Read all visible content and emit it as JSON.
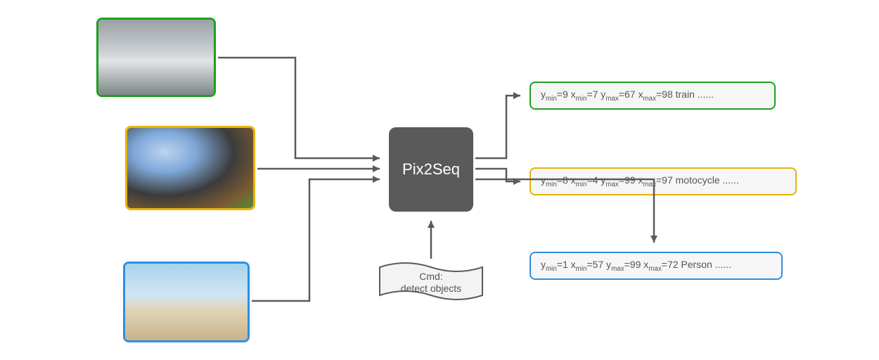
{
  "model": {
    "label": "Pix2Seq"
  },
  "command": {
    "line1": "Cmd:",
    "line2": "detect objects"
  },
  "inputs": [
    {
      "id": "train",
      "border": "#1ea01e",
      "bg_top": "#8a8f8a",
      "bg_bot": "#cfd3cf",
      "desc": "bullet-train-photo"
    },
    {
      "id": "moto",
      "border": "#e8b400",
      "bg_top": "#6aa0e0",
      "bg_bot": "#8a6a40",
      "desc": "motorcycle-photo"
    },
    {
      "id": "person",
      "border": "#2e8fe0",
      "bg_top": "#9ec8e8",
      "bg_bot": "#d9c8a8",
      "desc": "person-bicycle-photo"
    }
  ],
  "outputs": [
    {
      "id": "train",
      "border": "#1ea01e",
      "ymin": 9,
      "xmin": 7,
      "ymax": 67,
      "xmax": 98,
      "label": "train",
      "suffix": " ......"
    },
    {
      "id": "moto",
      "border": "#e8b400",
      "ymin": 8,
      "xmin": 4,
      "ymax": 99,
      "xmax": 97,
      "label": "motocycle",
      "suffix": " ......"
    },
    {
      "id": "person",
      "border": "#2e8fe0",
      "ymin": 1,
      "xmin": 57,
      "ymax": 99,
      "xmax": 72,
      "label": "Person",
      "suffix": " ......"
    }
  ]
}
